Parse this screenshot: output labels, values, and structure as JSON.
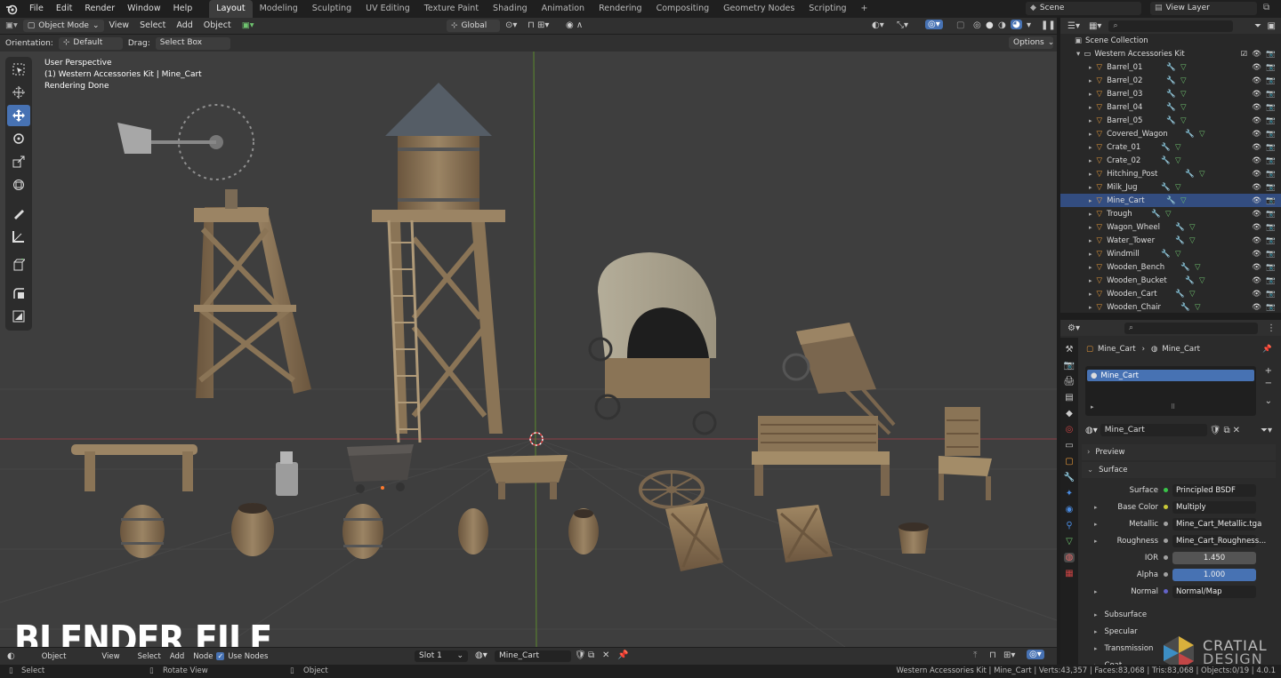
{
  "topbar": {
    "menus": [
      "File",
      "Edit",
      "Render",
      "Window",
      "Help"
    ],
    "workspaces": [
      "Layout",
      "Modeling",
      "Sculpting",
      "UV Editing",
      "Texture Paint",
      "Shading",
      "Animation",
      "Rendering",
      "Compositing",
      "Geometry Nodes",
      "Scripting"
    ],
    "active_workspace": "Layout",
    "add_tab": "+",
    "scene": "Scene",
    "view_layer": "View Layer"
  },
  "header": {
    "mode": "Object Mode",
    "menus": [
      "View",
      "Select",
      "Add",
      "Object"
    ],
    "transform": "Global",
    "orientation_label": "Orientation:",
    "orientation_value": "Default",
    "drag_label": "Drag:",
    "drag_value": "Select Box",
    "options": "Options"
  },
  "viewport": {
    "line1": "User Perspective",
    "line2": "(1) Western Accessories Kit | Mine_Cart",
    "line3": "Rendering Done",
    "watermark": "BLENDER FILE",
    "brand_name": "CRATIAL",
    "brand_sub": "DESIGN"
  },
  "tools": [
    "select-box-icon",
    "cursor-icon",
    "move-icon",
    "rotate-icon",
    "scale-icon",
    "transform-icon",
    "annotate-icon",
    "measure-icon",
    "add-cube-icon",
    "extrude-icon",
    "shear-icon"
  ],
  "outliner": {
    "search_placeholder": "",
    "scene_collection": "Scene Collection",
    "collection": "Western Accessories Kit",
    "items": [
      "Barrel_01",
      "Barrel_02",
      "Barrel_03",
      "Barrel_04",
      "Barrel_05",
      "Covered_Wagon",
      "Crate_01",
      "Crate_02",
      "Hitching_Post",
      "Milk_Jug",
      "Mine_Cart",
      "Trough",
      "Wagon_Wheel",
      "Water_Tower",
      "Windmill",
      "Wooden_Bench",
      "Wooden_Bucket",
      "Wooden_Cart",
      "Wooden_Chair"
    ],
    "selected": "Mine_Cart"
  },
  "properties": {
    "breadcrumb_object": "Mine_Cart",
    "breadcrumb_material": "Mine_Cart",
    "slot_item": "Mine_Cart",
    "material_name": "Mine_Cart",
    "preview": "Preview",
    "surface_panel": "Surface",
    "rows": [
      {
        "label": "Surface",
        "value": "Principled BSDF",
        "dot": "#39c449",
        "style": "dark",
        "arrow": false
      },
      {
        "label": "Base Color",
        "value": "Multiply",
        "dot": "#c8c838",
        "style": "dark",
        "arrow": true
      },
      {
        "label": "Metallic",
        "value": "Mine_Cart_Metallic.tga",
        "dot": "#a1a1a1",
        "style": "dark",
        "arrow": true
      },
      {
        "label": "Roughness",
        "value": "Mine_Cart_Roughness...",
        "dot": "#a1a1a1",
        "style": "dark",
        "arrow": true
      },
      {
        "label": "IOR",
        "value": "1.450",
        "dot": "#a1a1a1",
        "style": "num",
        "arrow": false
      },
      {
        "label": "Alpha",
        "value": "1.000",
        "dot": "#a1a1a1",
        "style": "blue",
        "arrow": false
      },
      {
        "label": "Normal",
        "value": "Normal/Map",
        "dot": "#6363c7",
        "style": "dark",
        "arrow": true
      }
    ],
    "subpanels": [
      "Subsurface",
      "Specular",
      "Transmission",
      "Coat"
    ]
  },
  "material_header": {
    "object_label": "Object",
    "view": "View",
    "select": "Select",
    "add": "Add",
    "node": "Node",
    "use_nodes": "Use Nodes",
    "slot": "Slot 1",
    "material": "Mine_Cart"
  },
  "statusbar": {
    "select": "Select",
    "rotate": "Rotate View",
    "object": "Object",
    "stats": "Western Accessories Kit | Mine_Cart | Verts:43,357 | Faces:83,068 | Tris:83,068 | Objects:0/19 | 4.0.1"
  }
}
